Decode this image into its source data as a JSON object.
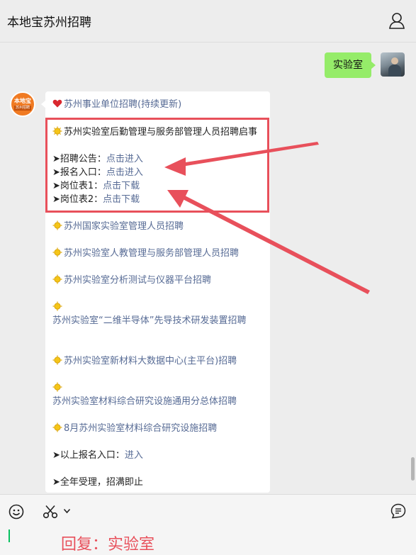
{
  "header": {
    "title": "本地宝苏州招聘"
  },
  "sent_message": {
    "text": "实验室"
  },
  "bot_avatar": {
    "logo_text": "本地宝",
    "logo_sub": "苏州招聘"
  },
  "message": {
    "heading": "苏州事业单位招聘(持续更新)",
    "highlight_title": "苏州实验室后勤管理与服务部管理人员招聘启事",
    "items": [
      {
        "prefix": "➤招聘公告：",
        "link": "点击进入"
      },
      {
        "prefix": "➤报名入口：",
        "link": "点击进入"
      },
      {
        "prefix": "➤岗位表1：",
        "link": "点击下载"
      },
      {
        "prefix": "➤岗位表2：",
        "link": "点击下载"
      }
    ],
    "links": [
      "苏州国家实验室管理人员招聘",
      "苏州实验室人教管理与服务部管理人员招聘",
      "苏州实验室分析测试与仪器平台招聘",
      "苏州实验室“二维半导体”先导技术研发装置招聘",
      "苏州实验室新材料大数据中心(主平台)招聘",
      "苏州实验室材料综合研究设施通用分总体招聘",
      "8月苏州实验室材料综合研究设施招聘"
    ],
    "entry_prefix": "➤以上报名入口：",
    "entry_link": "进入",
    "footer": "➤全年受理，招满即止"
  },
  "reply_note": "回复：实验室",
  "icons": [
    "profile-icon",
    "heart-icon",
    "sun-emoji-icon",
    "emoji-icon",
    "scissors-icon",
    "chevron-down-icon",
    "voice-icon"
  ],
  "colors": {
    "bubble_green": "#95ec69",
    "highlight_red": "#e8505b",
    "link_blue": "#576b95",
    "background": "#ededed"
  }
}
